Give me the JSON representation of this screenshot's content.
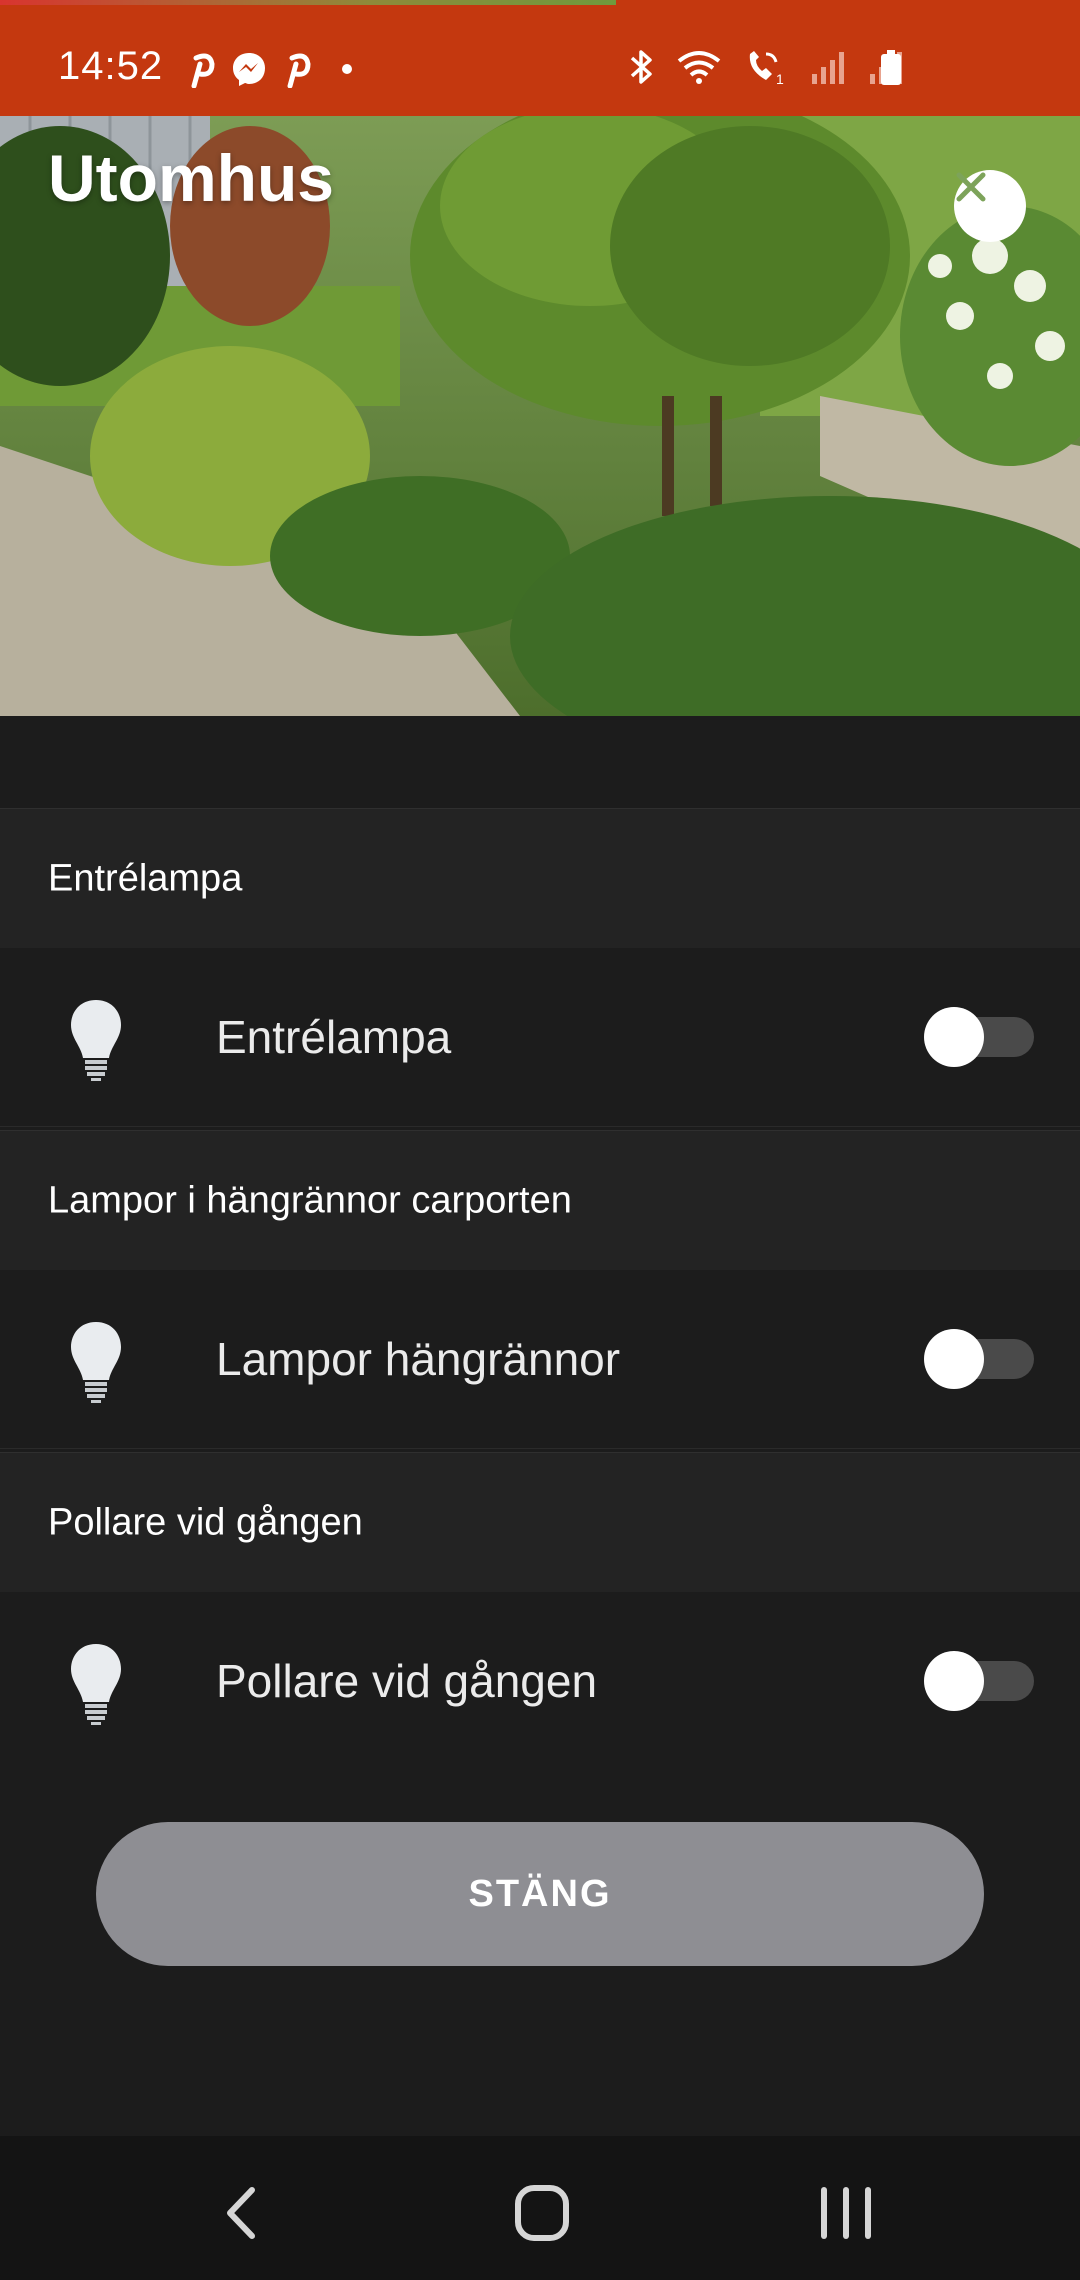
{
  "status_bar": {
    "time": "14:52",
    "left_icons": [
      "pinterest-icon",
      "messenger-icon",
      "pinterest-icon",
      "dot-icon"
    ],
    "right_icons": [
      "bluetooth-icon",
      "wifi-icon",
      "wifi-calling-icon",
      "signal-icon",
      "signal-icon",
      "battery-icon"
    ],
    "background": "#c4380f"
  },
  "hero": {
    "title": "Utomhus",
    "close_icon": "close-icon"
  },
  "groups": [
    {
      "header": "Entrélampa",
      "device": {
        "name": "Entrélampa",
        "icon": "lightbulb-icon",
        "on": false
      }
    },
    {
      "header": "Lampor i hängrännor carporten",
      "device": {
        "name": "Lampor hängrännor",
        "icon": "lightbulb-icon",
        "on": false
      }
    },
    {
      "header": "Pollare vid gången",
      "device": {
        "name": "Pollare vid gången",
        "icon": "lightbulb-icon",
        "on": false
      }
    }
  ],
  "close_button": {
    "label": "STÄNG",
    "color": "#8e8e93"
  },
  "nav_bar": {
    "icons": [
      "back-icon",
      "home-icon",
      "recents-icon"
    ]
  }
}
